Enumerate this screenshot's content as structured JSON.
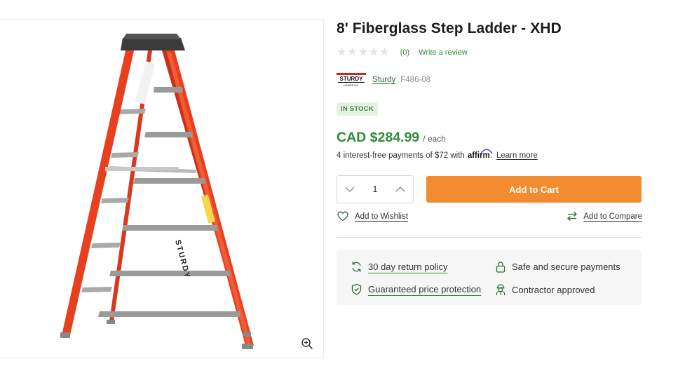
{
  "product": {
    "title": "8' Fiberglass Step Ladder - XHD",
    "rating_count": "(0)",
    "write_review": "Write a review",
    "brand_logo_text": "STURDY",
    "brand_logo_subtext": "LADDER INC.",
    "brand": "Sturdy",
    "sku": "F486-08",
    "stock_status": "IN STOCK",
    "price": "CAD $284.99",
    "price_unit": "/ each",
    "rating_value": 0,
    "rating_max": 5,
    "ladder_rail_text": "STURDY"
  },
  "affirm": {
    "text": "4 interest-free payments of $72 with",
    "logo": "affirm",
    "learn_more": "Learn more"
  },
  "cart": {
    "quantity": "1",
    "add_to_cart": "Add to Cart",
    "add_to_wishlist": "Add to Wishlist",
    "add_to_compare": "Add to Compare"
  },
  "benefits": {
    "return_policy": "30 day return policy",
    "secure_payments": "Safe and secure payments",
    "price_protection": "Guaranteed price protection",
    "contractor": "Contractor approved"
  },
  "colors": {
    "accent_green": "#2e8b3a",
    "cta_orange": "#f28c31",
    "ladder_orange": "#e8401e"
  }
}
